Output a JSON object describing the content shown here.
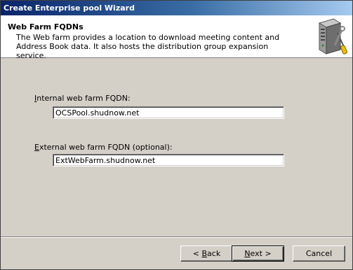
{
  "window": {
    "title": "Create Enterprise pool Wizard"
  },
  "header": {
    "title": "Web Farm FQDNs",
    "description": "The Web farm provides a location to download meeting content and Address Book data. It also hosts the distribution group expansion service.",
    "icon": "server-with-tools-icon"
  },
  "fields": {
    "internal": {
      "label_accel": "I",
      "label_rest": "nternal web farm FQDN:",
      "value": "OCSPool.shudnow.net"
    },
    "external": {
      "label_accel": "E",
      "label_rest": "xternal web farm FQDN (optional):",
      "value": "ExtWebFarm.shudnow.net"
    }
  },
  "buttons": {
    "back": {
      "prefix": "< ",
      "accel": "B",
      "rest": "ack"
    },
    "next": {
      "accel": "N",
      "rest": "ext >"
    },
    "cancel": {
      "label": "Cancel"
    }
  }
}
